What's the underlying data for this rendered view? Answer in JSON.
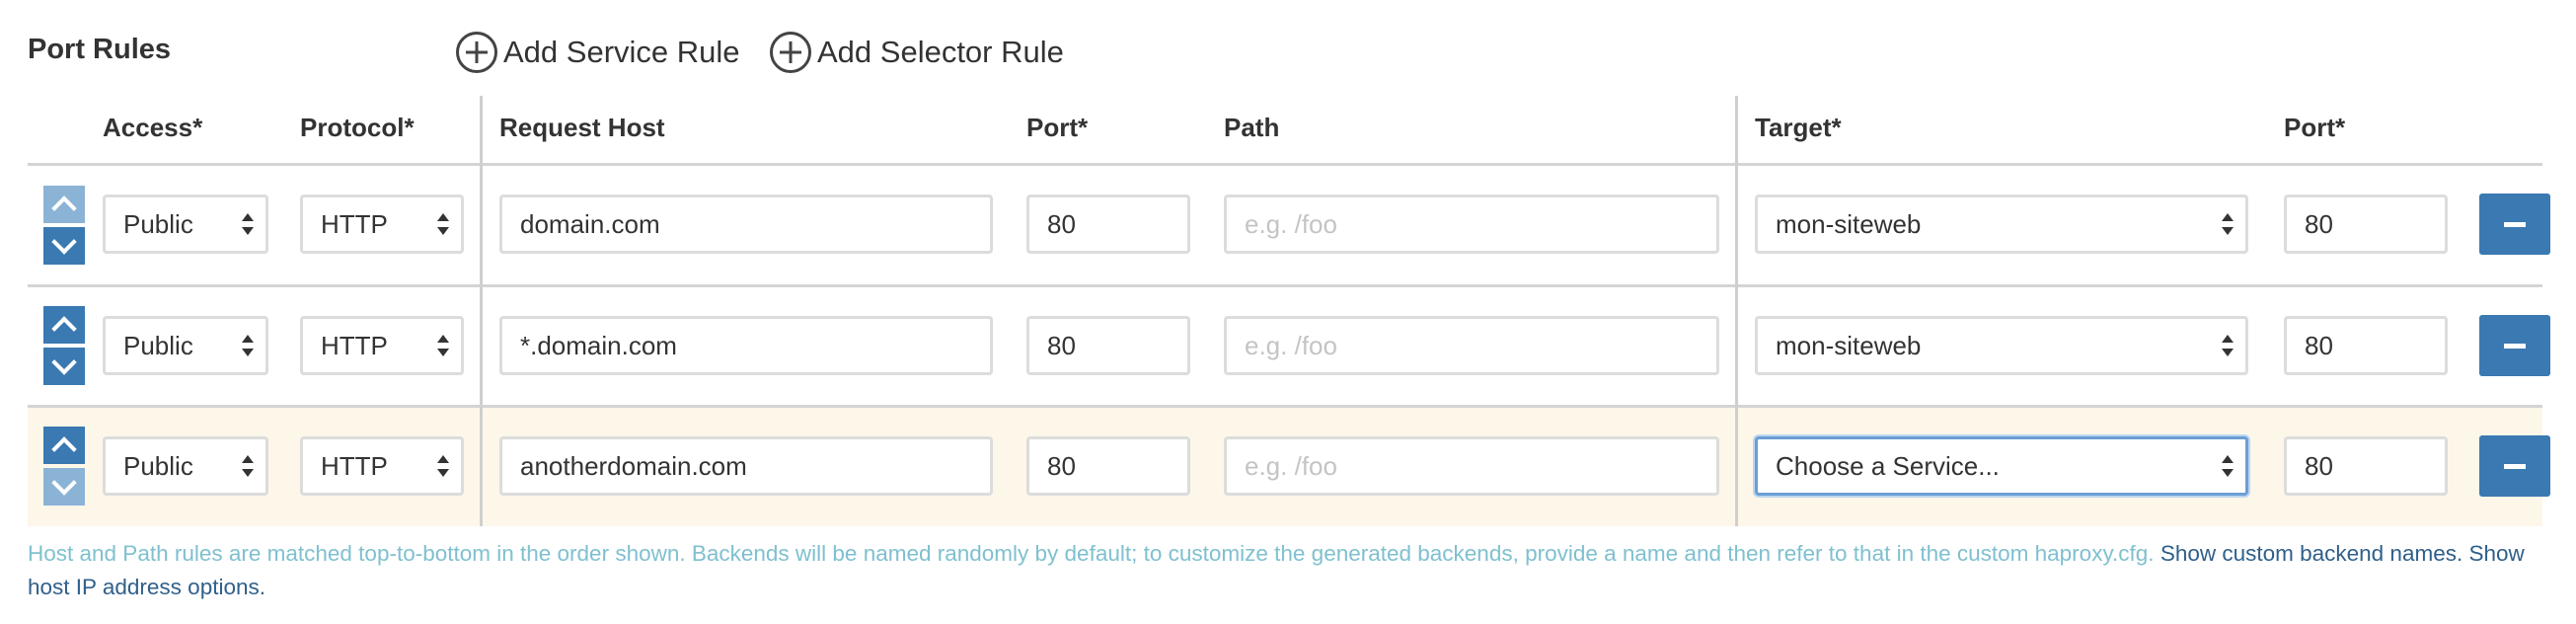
{
  "section": {
    "title": "Port Rules",
    "add_service_label": "Add Service Rule",
    "add_selector_label": "Add Selector Rule"
  },
  "headers": {
    "access": "Access*",
    "protocol": "Protocol*",
    "request_host": "Request Host",
    "port": "Port*",
    "path": "Path",
    "target": "Target*",
    "target_port": "Port*"
  },
  "rows": [
    {
      "access": "Public",
      "protocol": "HTTP",
      "host": "domain.com",
      "port": "80",
      "path_placeholder": "e.g. /foo",
      "target": "mon-siteweb",
      "target_port": "80"
    },
    {
      "access": "Public",
      "protocol": "HTTP",
      "host": "*.domain.com",
      "port": "80",
      "path_placeholder": "e.g. /foo",
      "target": "mon-siteweb",
      "target_port": "80"
    },
    {
      "access": "Public",
      "protocol": "HTTP",
      "host": "anotherdomain.com",
      "port": "80",
      "path_placeholder": "e.g. /foo",
      "target": "Choose a Service...",
      "target_port": "80"
    }
  ],
  "help": {
    "text": "Host and Path rules are matched top-to-bottom in the order shown. Backends will be named randomly by default; to customize the generated backends, provide a name and then refer to that in the custom haproxy.cfg.",
    "link_backend": "Show custom backend names.",
    "link_ip": "Show host IP address options."
  },
  "icons": {
    "add": "plus-circle-icon",
    "move_up": "chevron-up-icon",
    "move_down": "chevron-down-icon",
    "remove": "minus-icon",
    "select": "select-arrows-icon"
  },
  "colors": {
    "accent": "#3a79b1",
    "accent_disabled": "#8bb3d6",
    "highlight_row": "#fdf7ea",
    "help_text": "#7fc0cf",
    "link": "#2f5f8a",
    "focus_border": "#6a9fd4"
  }
}
